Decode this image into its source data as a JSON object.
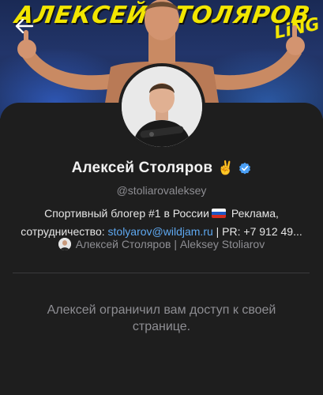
{
  "cover": {
    "title": "АЛЕКСЕЙ СТОЛЯРОВ",
    "logo_text": "LiNG",
    "accent": "#f2e600"
  },
  "navigation": {
    "back_icon": "arrow-left-icon"
  },
  "profile": {
    "name": "Алексей Столяров",
    "name_emoji": "✌️",
    "verified_icon": "verified-badge-icon",
    "verified_color": "#4a9ff5",
    "username": "@stoliarovaleksey",
    "bio_line1": "Спортивный блогер #1 в России",
    "bio_flag_icon": "russia-flag-icon",
    "bio_line1_tail": " Реклама,",
    "bio_line2_prefix": "сотрудничество: ",
    "bio_email": "stolyarov@wildjam.ru",
    "bio_line2_suffix": " | PR: +7 912 49...",
    "linked_account": "Алексей Столяров | Aleksey Stoliarov"
  },
  "restricted_message": "Алексей ограничил вам доступ к своей странице."
}
